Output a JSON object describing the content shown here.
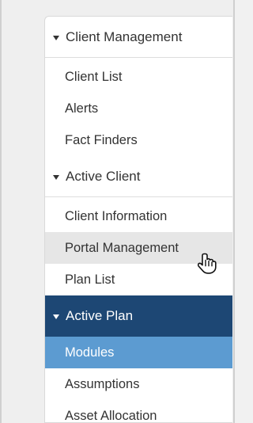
{
  "sidebar": {
    "client_management": {
      "header": "Client Management",
      "items": [
        "Client List",
        "Alerts",
        "Fact Finders"
      ]
    },
    "active_client": {
      "header": "Active Client",
      "items": [
        "Client Information",
        "Portal Management",
        "Plan List"
      ]
    },
    "active_plan": {
      "header": "Active Plan",
      "items": [
        "Modules",
        "Assumptions",
        "Asset Allocation"
      ]
    }
  },
  "colors": {
    "active_header": "#1d4774",
    "selected_item": "#5c9bd1",
    "hover_item": "#e6e6e6"
  }
}
